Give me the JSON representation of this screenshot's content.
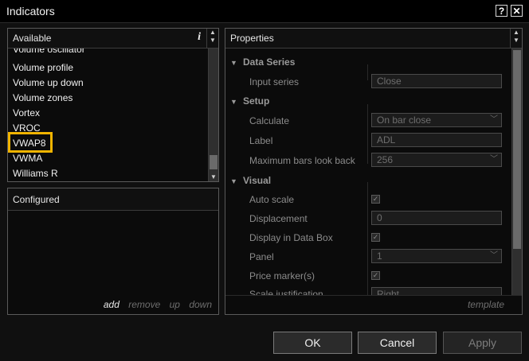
{
  "window": {
    "title": "Indicators",
    "help_label": "?",
    "close_label": "✕"
  },
  "available": {
    "title": "Available",
    "info_label": "i",
    "items": [
      "Volume oscillator",
      "Volume profile",
      "Volume up down",
      "Volume zones",
      "Vortex",
      "VROC",
      "VWAP8",
      "VWMA",
      "Williams R"
    ],
    "selected": "VWAP8"
  },
  "configured": {
    "title": "Configured",
    "actions": {
      "add": "add",
      "remove": "remove",
      "up": "up",
      "down": "down"
    }
  },
  "properties": {
    "title": "Properties",
    "data_series": {
      "label": "Data Series",
      "input_series_label": "Input series",
      "input_series_value": "Close"
    },
    "setup": {
      "label": "Setup",
      "calculate_label": "Calculate",
      "calculate_value": "On bar close",
      "label_label": "Label",
      "label_value": "ADL",
      "max_bars_label": "Maximum bars look back",
      "max_bars_value": "256"
    },
    "visual": {
      "label": "Visual",
      "auto_scale_label": "Auto scale",
      "displacement_label": "Displacement",
      "displacement_value": "0",
      "display_databox_label": "Display in Data Box",
      "panel_label": "Panel",
      "panel_value": "1",
      "price_marker_label": "Price marker(s)",
      "scale_justification_label": "Scale justification",
      "scale_justification_value": "Right"
    },
    "template_label": "template"
  },
  "buttons": {
    "ok": "OK",
    "cancel": "Cancel",
    "apply": "Apply"
  },
  "colors": {
    "highlight": "#f0b400",
    "background": "#101010"
  }
}
